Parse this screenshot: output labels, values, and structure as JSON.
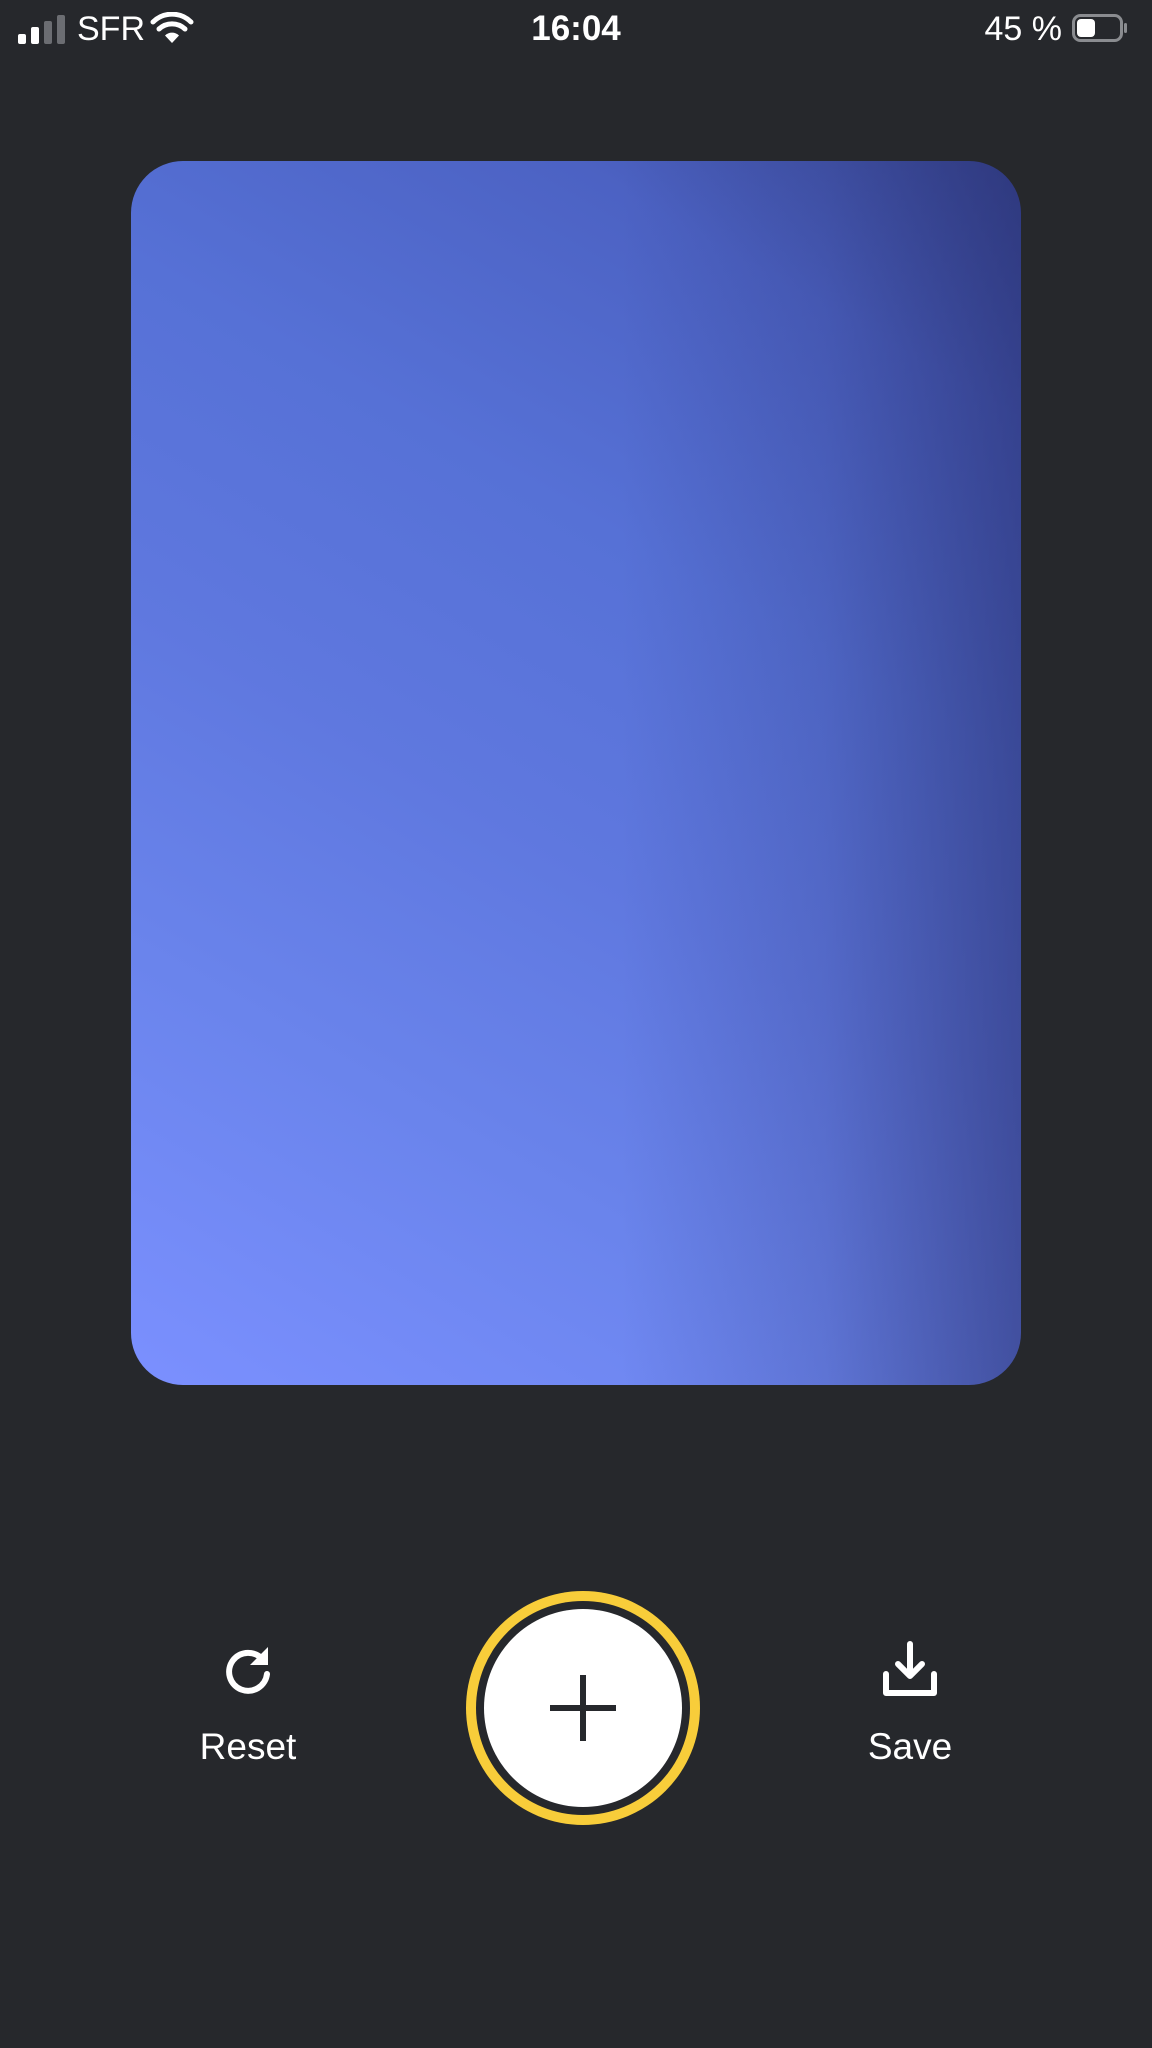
{
  "status_bar": {
    "carrier": "SFR",
    "time": "16:04",
    "battery_percent": "45 %",
    "battery_level": 0.45,
    "signal_bars_active": 2,
    "signal_bars_total": 4,
    "icons": [
      "signal-icon",
      "wifi-icon",
      "battery-icon"
    ]
  },
  "card": {
    "gradient_colors": [
      "#7b90ff",
      "#5f78df",
      "#3d4d9e"
    ]
  },
  "controls": {
    "reset_label": "Reset",
    "save_label": "Save",
    "reset_icon": "refresh-icon",
    "add_icon": "plus-icon",
    "save_icon": "download-icon"
  },
  "colors": {
    "background": "#26282c",
    "accent_ring": "#f8cd3a",
    "text": "#ffffff"
  }
}
